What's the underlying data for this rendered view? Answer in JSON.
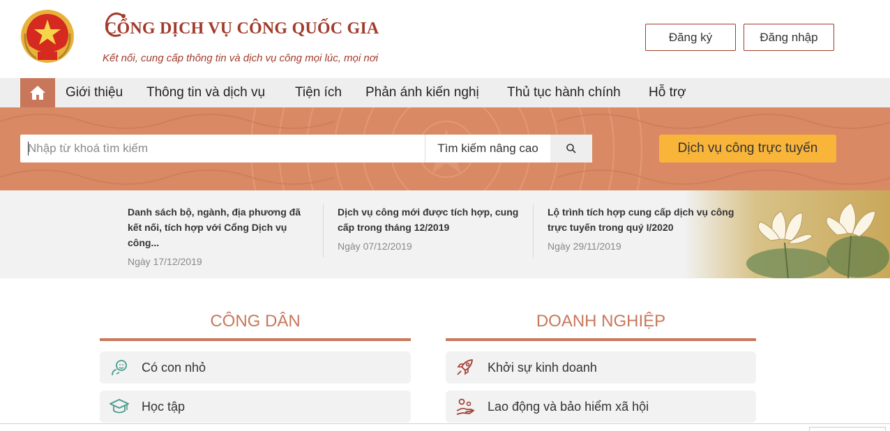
{
  "header": {
    "title": "CỔNG DỊCH VỤ CÔNG QUỐC GIA",
    "slogan": "Kết nối, cung cấp thông tin và dịch vụ công mọi lúc, mọi nơi",
    "register_label": "Đăng ký",
    "login_label": "Đăng nhập",
    "emblem_icon": "national-emblem"
  },
  "nav": {
    "home_icon": "home-icon",
    "items": [
      "Giới thiệu",
      "Thông tin và dịch vụ",
      "Tiện ích",
      "Phản ánh kiến nghị",
      "Thủ tục hành chính",
      "Hỗ trợ"
    ]
  },
  "search": {
    "placeholder": "Nhập từ khoá tìm kiếm",
    "value": "",
    "advanced_label": "Tìm kiếm nâng cao",
    "search_icon": "search-icon",
    "online_services_label": "Dịch vụ công trực tuyến"
  },
  "news": [
    {
      "title": "Danh sách bộ, ngành, địa phương đã kết nối, tích hợp với Cổng Dịch vụ công...",
      "date": "Ngày 17/12/2019"
    },
    {
      "title": "Dịch vụ công mới được tích hợp, cung cấp trong tháng 12/2019",
      "date": "Ngày 07/12/2019"
    },
    {
      "title": "Lộ trình tích hợp cung cấp dịch vụ công trực tuyến trong quý I/2020",
      "date": "Ngày 29/11/2019"
    }
  ],
  "sections": {
    "citizen": {
      "title": "CÔNG DÂN",
      "items": [
        {
          "label": "Có con nhỏ",
          "icon": "baby-icon"
        },
        {
          "label": "Học tập",
          "icon": "graduation-cap-icon"
        }
      ]
    },
    "business": {
      "title": "DOANH NGHIỆP",
      "items": [
        {
          "label": "Khởi sự kinh doanh",
          "icon": "rocket-icon"
        },
        {
          "label": "Lao động và bảo hiểm xã hội",
          "icon": "worker-hand-icon"
        }
      ]
    }
  },
  "colors": {
    "brand_red": "#a23b2c",
    "accent_orange": "#c8775a",
    "banner_orange": "#d98a64",
    "cta_yellow": "#f9b43a",
    "icon_teal": "#4a9a8e"
  }
}
